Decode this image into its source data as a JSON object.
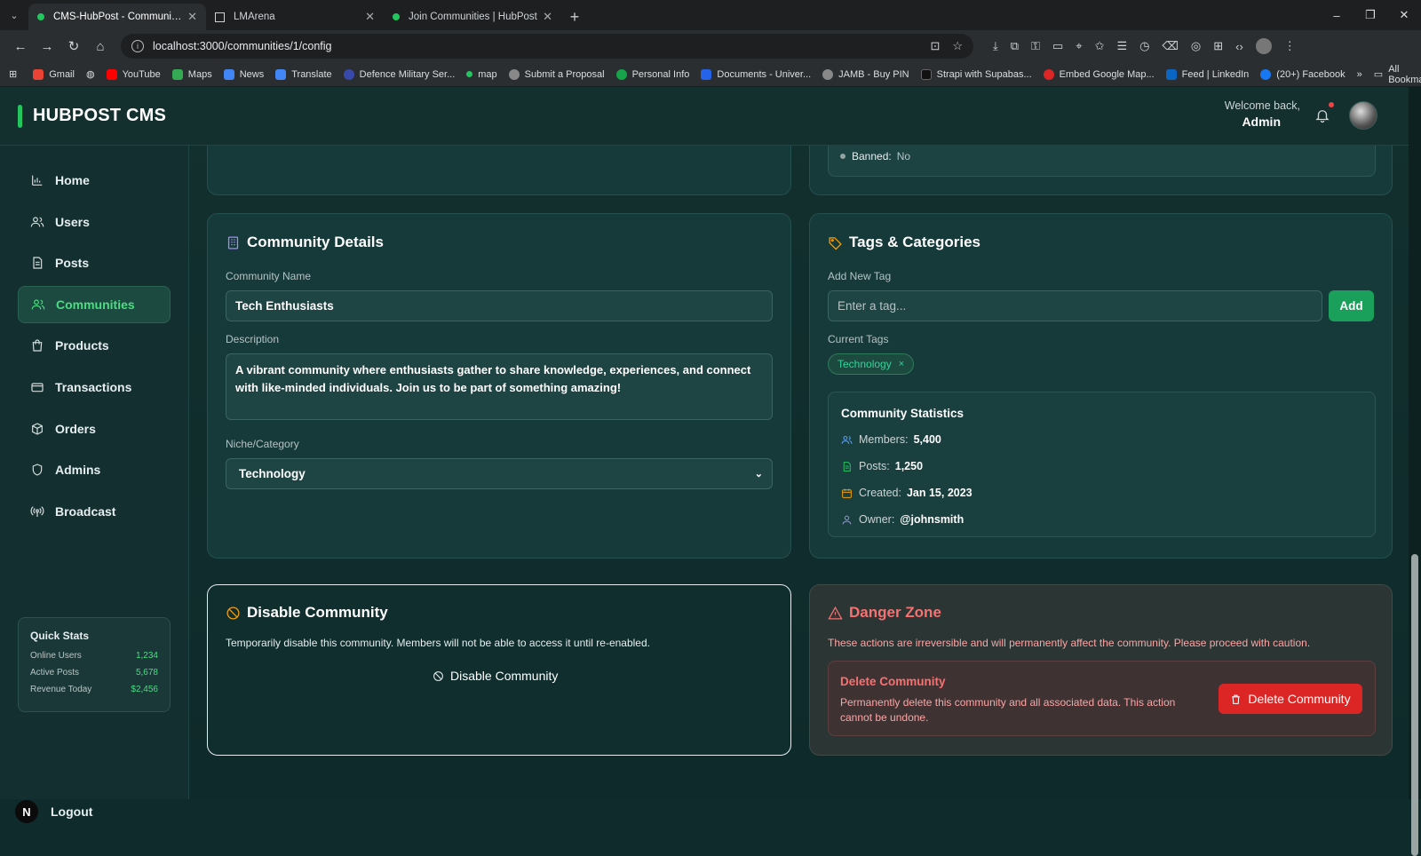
{
  "browser": {
    "tabs": [
      {
        "label": "CMS-HubPost - Community Ma",
        "active": true
      },
      {
        "label": "LMArena",
        "active": false
      },
      {
        "label": "Join Communities | HubPost",
        "active": false
      }
    ],
    "url": "localhost:3000/communities/1/config",
    "bookmarks": [
      "Gmail",
      "YouTube",
      "Maps",
      "News",
      "Translate",
      "Defence Military Ser...",
      "map",
      "Submit a Proposal",
      "Personal Info",
      "Documents - Univer...",
      "JAMB - Buy PIN",
      "Strapi with Supabas...",
      "Embed Google Map...",
      "Feed | LinkedIn",
      "(20+) Facebook"
    ],
    "all_bookmarks": "All Bookmarks"
  },
  "header": {
    "brand": "HUBPOST CMS",
    "welcome": "Welcome back,",
    "user": "Admin"
  },
  "sidebar": {
    "items": [
      {
        "label": "Home",
        "icon": "chart-icon"
      },
      {
        "label": "Users",
        "icon": "users-icon"
      },
      {
        "label": "Posts",
        "icon": "document-icon"
      },
      {
        "label": "Communities",
        "icon": "community-icon",
        "active": true
      },
      {
        "label": "Products",
        "icon": "bag-icon"
      },
      {
        "label": "Transactions",
        "icon": "card-icon"
      },
      {
        "label": "Orders",
        "icon": "box-icon"
      },
      {
        "label": "Admins",
        "icon": "shield-icon"
      },
      {
        "label": "Broadcast",
        "icon": "broadcast-icon"
      }
    ],
    "quick_stats": {
      "title": "Quick Stats",
      "rows": [
        {
          "label": "Online Users",
          "value": "1,234"
        },
        {
          "label": "Active Posts",
          "value": "5,678"
        },
        {
          "label": "Revenue Today",
          "value": "$2,456"
        }
      ]
    },
    "logout": "Logout",
    "badge": "N"
  },
  "status_partial": {
    "label": "Banned:",
    "value": "No"
  },
  "details": {
    "title": "Community Details",
    "name_label": "Community Name",
    "name_value": "Tech Enthusiasts",
    "desc_label": "Description",
    "desc_value": "A vibrant community where enthusiasts gather to share knowledge, experiences, and connect with like-minded individuals. Join us to be part of something amazing!",
    "niche_label": "Niche/Category",
    "niche_value": "Technology"
  },
  "tags": {
    "title": "Tags & Categories",
    "add_label": "Add New Tag",
    "placeholder": "Enter a tag...",
    "add_button": "Add",
    "current_label": "Current Tags",
    "current": [
      "Technology"
    ],
    "remove_glyph": "×"
  },
  "stats": {
    "title": "Community Statistics",
    "rows": [
      {
        "label": "Members:",
        "value": "5,400"
      },
      {
        "label": "Posts:",
        "value": "1,250"
      },
      {
        "label": "Created:",
        "value": "Jan 15, 2023"
      },
      {
        "label": "Owner:",
        "value": "@johnsmith"
      }
    ]
  },
  "disable": {
    "title": "Disable Community",
    "desc": "Temporarily disable this community. Members will not be able to access it until re-enabled.",
    "button": "Disable Community"
  },
  "danger": {
    "title": "Danger Zone",
    "desc": "These actions are irreversible and will permanently affect the community. Please proceed with caution.",
    "delete_title": "Delete Community",
    "delete_desc": "Permanently delete this community and all associated data. This action cannot be undone.",
    "delete_button": "Delete Community"
  },
  "colors": {
    "accent": "#22c55e",
    "danger": "#dc2626",
    "background": "#0f2b2b"
  }
}
